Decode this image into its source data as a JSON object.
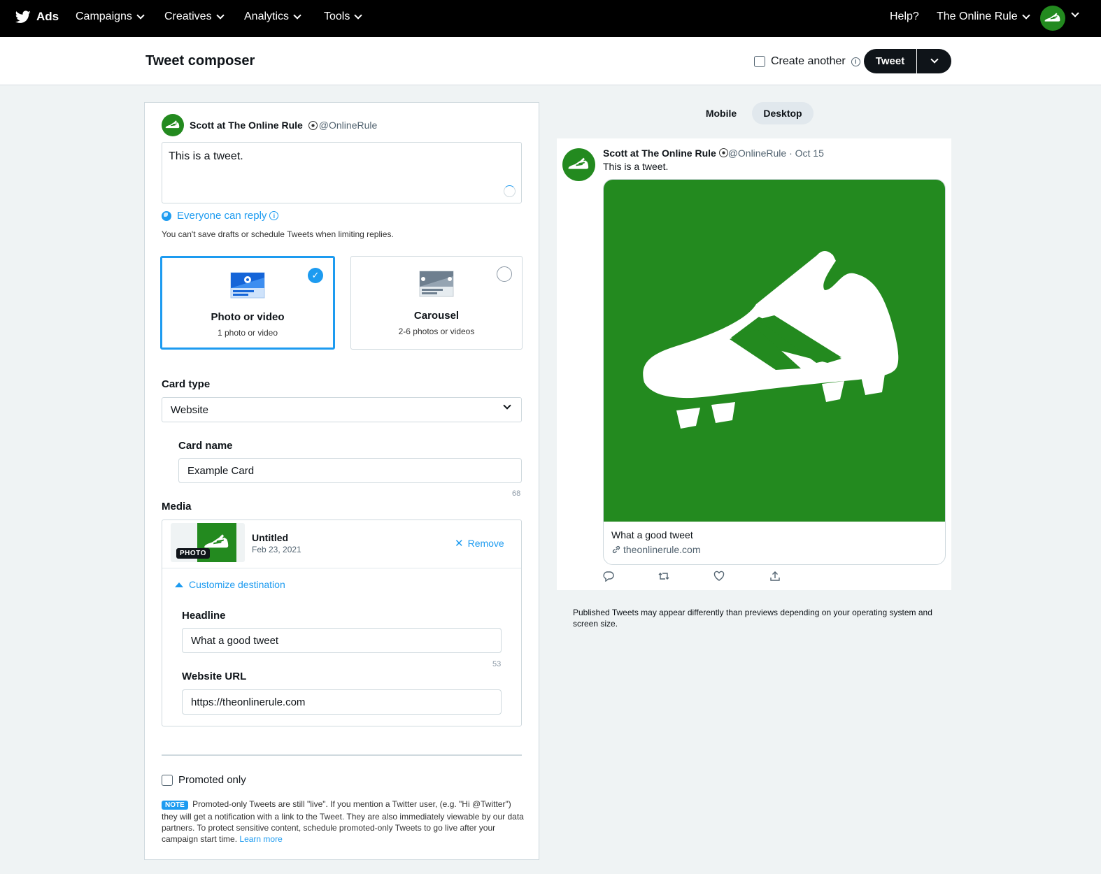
{
  "nav": {
    "brand": "Ads",
    "items": [
      {
        "label": "Campaigns"
      },
      {
        "label": "Creatives"
      },
      {
        "label": "Analytics"
      },
      {
        "label": "Tools"
      }
    ],
    "help": "Help?",
    "account": "The Online Rule"
  },
  "header": {
    "title": "Tweet composer",
    "create_another": "Create another",
    "tweet_button": "Tweet"
  },
  "composer": {
    "author_name": "Scott at The Online Rule",
    "author_handle": "@OnlineRule",
    "tweet_text": "This is a tweet.",
    "reply_setting": "Everyone can reply",
    "reply_note": "You can't save drafts or schedule Tweets when limiting replies.",
    "formats": [
      {
        "title": "Photo or video",
        "subtitle": "1 photo or video",
        "selected": true
      },
      {
        "title": "Carousel",
        "subtitle": "2-6 photos or videos",
        "selected": false
      }
    ],
    "card_type_label": "Card type",
    "card_type_value": "Website",
    "card_name_label": "Card name",
    "card_name_value": "Example Card",
    "card_name_count": "68",
    "media_label": "Media",
    "media": {
      "tag": "PHOTO",
      "title": "Untitled",
      "date": "Feb 23, 2021",
      "remove": "Remove",
      "customize": "Customize destination"
    },
    "headline_label": "Headline",
    "headline_value": "What a good tweet",
    "headline_count": "53",
    "url_label": "Website URL",
    "url_value": "https://theonlinerule.com",
    "promoted_label": "Promoted only",
    "note_tag": "NOTE",
    "note_text": "Promoted-only Tweets are still \"live\". If you mention a Twitter user, (e.g. \"Hi @Twitter\") they will get a notification with a link to the Tweet. They are also immediately viewable by our data partners. To protect sensitive content, schedule promoted-only Tweets to go live after your campaign start time.",
    "learn_more": "Learn more"
  },
  "preview": {
    "tab_mobile": "Mobile",
    "tab_desktop": "Desktop",
    "active_tab": "Desktop",
    "author_name": "Scott at The Online Rule",
    "author_handle": "@OnlineRule",
    "date": "· Oct 15",
    "text": "This is a tweet.",
    "card_headline": "What a good tweet",
    "card_domain": "theonlinerule.com",
    "disclaimer": "Published Tweets may appear differently than previews depending on your operating system and screen size."
  },
  "colors": {
    "accent": "#1d9bf0",
    "brand_green": "#238a1f",
    "nav_bg": "#000000"
  }
}
